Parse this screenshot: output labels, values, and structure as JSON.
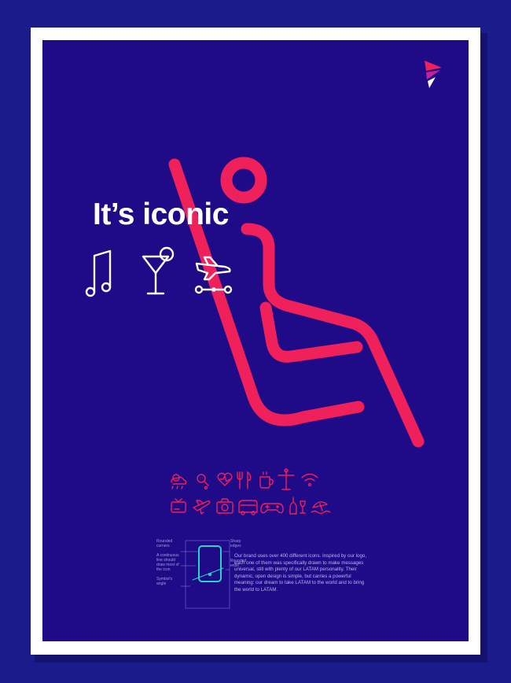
{
  "title": "It’s iconic",
  "body_text": "Our brand uses over 400 different icons. Inspired by our logo, each one of them was specifically drawn to make messages universal, still with plenty of our LATAM personality. Their dynamic, open design is simple, but carries a powerful meaning: our dream to take LATAM to the world and to bring the world to LATAM.",
  "diagram_labels": {
    "rounded_corners": "Rounded corners",
    "continuous_line": "A continuous line should draw most of the icon",
    "symbols_angle": "Symbol's angle",
    "sharp_edges": "Sharp edges",
    "rounded_ends": "Rounded ends"
  },
  "colors": {
    "background": "#1c1b8c",
    "frame": "#ffffff",
    "poster": "#1f0a88",
    "accent": "#f0205a",
    "icon_line": "#ffffff",
    "diagram": "#2ad4c8"
  },
  "icons": {
    "header": [
      "music-note-icon",
      "cocktail-icon",
      "plane-route-icon"
    ],
    "hero": "seated-passenger-icon",
    "logo": "latam-logo-icon",
    "grid_row1": [
      "weather-icon",
      "search-icon",
      "heart-icon",
      "dining-icon",
      "coffee-icon",
      "statue-icon",
      "wifi-icon"
    ],
    "grid_row2": [
      "tv-icon",
      "plane-icon",
      "camera-icon",
      "bus-icon",
      "gamepad-icon",
      "wine-icon",
      "beach-icon"
    ]
  }
}
